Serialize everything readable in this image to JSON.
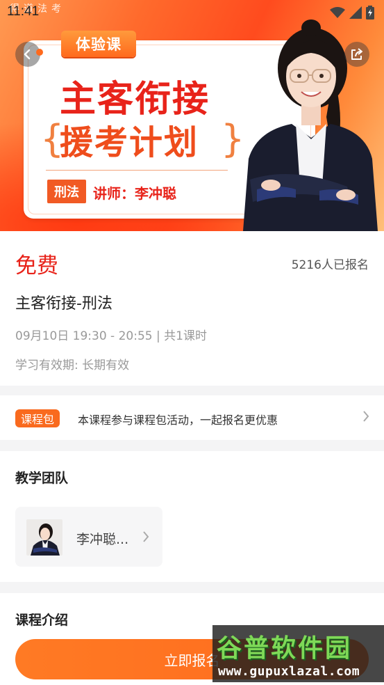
{
  "status_bar": {
    "time": "11:41",
    "logo_text": "得道法考"
  },
  "banner": {
    "tag": "体验课",
    "title_line1": "主客衔接",
    "title_line2": "援考计划",
    "brace_left": "{",
    "brace_right": "}",
    "subject_tag": "刑法",
    "teacher_line": "讲师：李冲聪",
    "accent_color": "#e8231a"
  },
  "course": {
    "price": "免费",
    "enrolled": "5216人已报名",
    "title": "主客衔接-刑法",
    "schedule": "09月10日 19:30 -  20:55 | 共1课时",
    "validity": "学习有效期: 长期有效"
  },
  "package": {
    "badge": "课程包",
    "text": "本课程参与课程包活动，一起报名更优惠"
  },
  "team": {
    "title": "教学团队",
    "teacher_name": "李冲聪..."
  },
  "intro": {
    "title": "课程介绍"
  },
  "cta": {
    "label": "立即报名"
  },
  "watermark": {
    "brand": "谷普软件园",
    "url": "www.gupuxlazal.com"
  },
  "icons": {
    "back": "back-arrow-icon",
    "share": "share-icon",
    "chevron": "chevron-right-icon",
    "wifi": "wifi-icon",
    "signal": "signal-icon",
    "battery": "battery-icon"
  }
}
